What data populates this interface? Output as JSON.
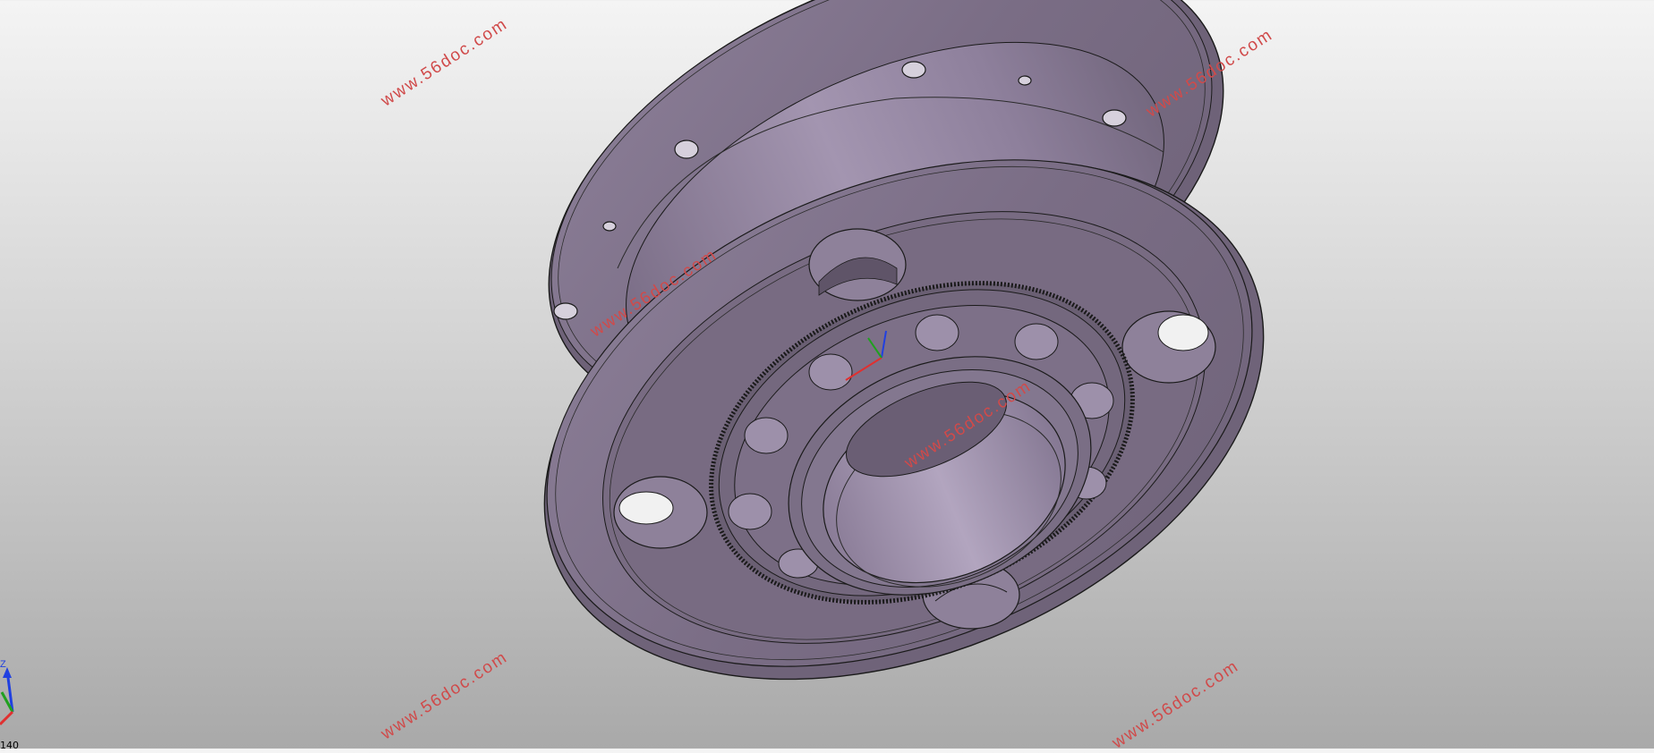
{
  "viewport": {
    "background_top": "#f4f4f4",
    "background_bottom": "#a9a9a9",
    "model": {
      "name": "gear-housing",
      "face_color": "#7c6f86",
      "highlight_color": "#a597b0",
      "edge_color": "#1a1a1a"
    }
  },
  "watermarks": [
    "www.56doc.com",
    "www.56doc.com",
    "www.56doc.com",
    "www.56doc.com",
    "www.56doc.com",
    "www.56doc.com"
  ],
  "triad": {
    "z_label": "Z",
    "colors": {
      "x": "#e03030",
      "y": "#20a020",
      "z": "#2040e0"
    }
  },
  "status": {
    "scale_label": "140"
  }
}
